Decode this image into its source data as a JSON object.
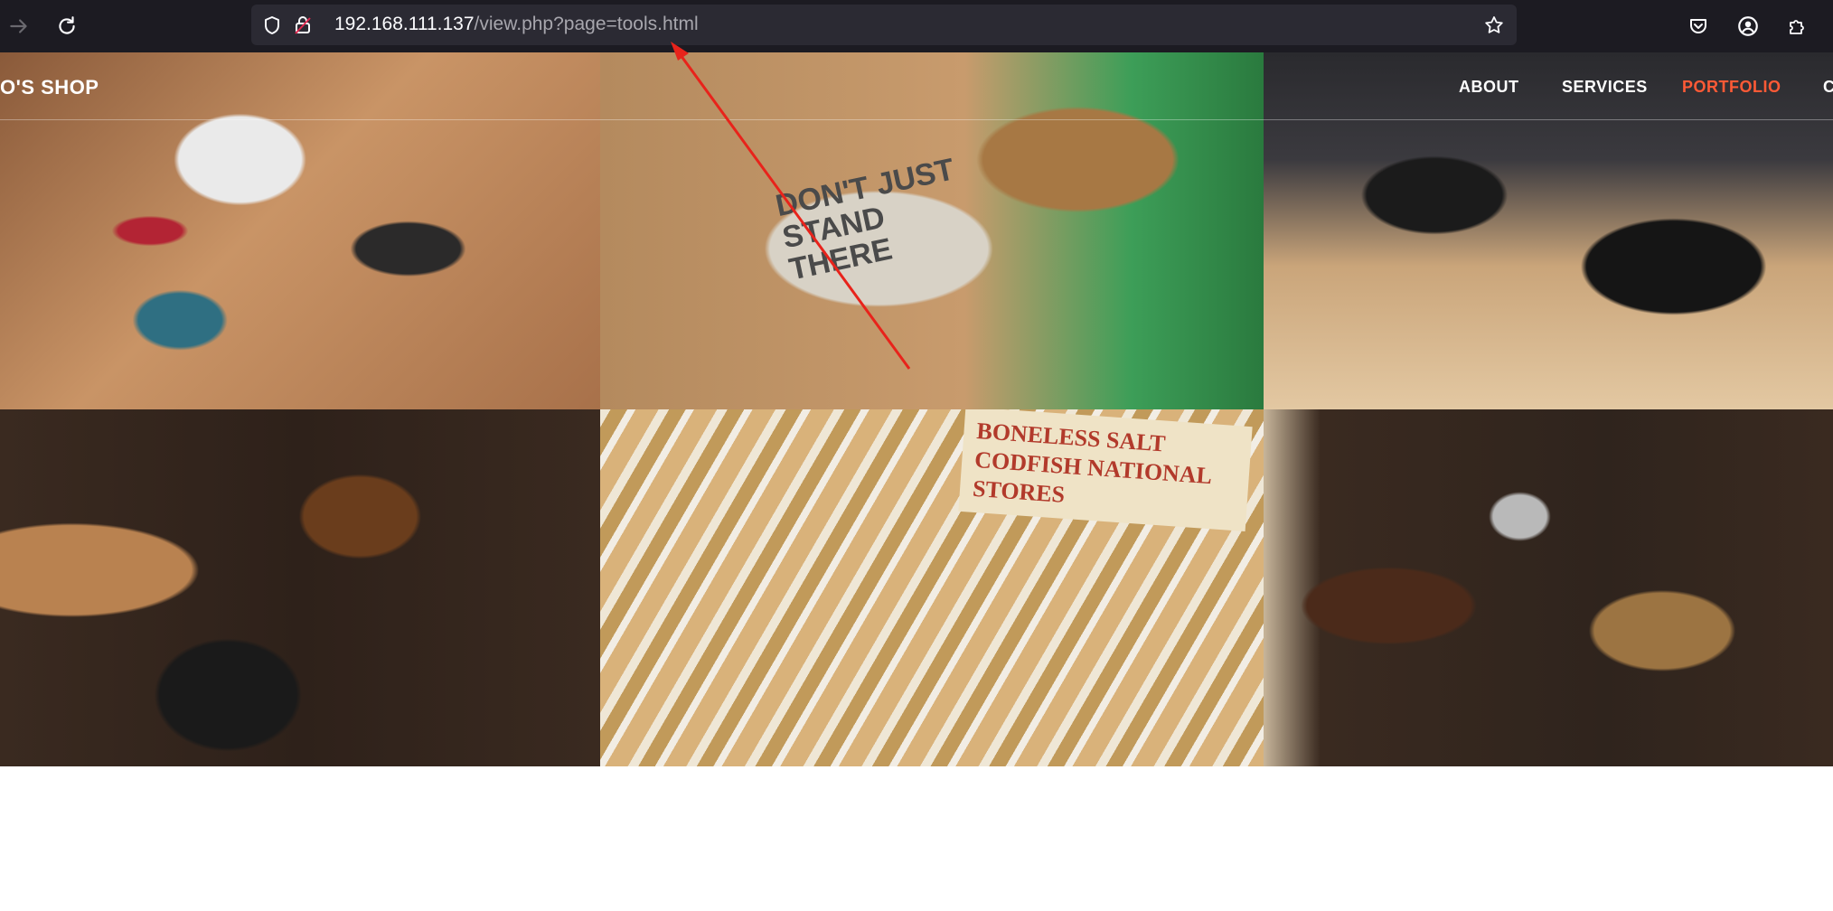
{
  "browser": {
    "url_host": "192.168.111.137",
    "url_path": "/view.php?page=tools.html",
    "icons": {
      "forward": "arrow-right-icon",
      "reload": "reload-icon",
      "tracking": "shield-icon",
      "insecure": "insecure-lock-icon",
      "bookmark": "star-icon",
      "pocket": "pocket-icon",
      "account": "account-icon",
      "extensions": "puzzle-icon"
    }
  },
  "site": {
    "brand": "O'S SHOP",
    "menu": [
      {
        "label": "ABOUT",
        "active": false
      },
      {
        "label": "SERVICES",
        "active": false
      },
      {
        "label": "PORTFOLIO",
        "active": true
      },
      {
        "label": "C",
        "active": false
      }
    ],
    "accent_color": "#ff5a36"
  },
  "gallery": {
    "tiles": [
      {
        "text": ""
      },
      {
        "text": "DON'T JUST STAND THERE"
      },
      {
        "text": ""
      },
      {
        "text": ""
      },
      {
        "text": "BONELESS SALT CODFISH NATIONAL STORES"
      },
      {
        "text": ""
      }
    ]
  },
  "annotation": {
    "color": "#e8231b"
  }
}
